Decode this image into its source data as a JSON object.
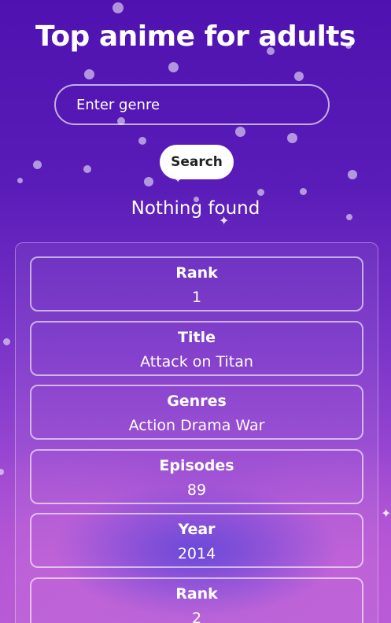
{
  "header": {
    "title": "Top anime for adults"
  },
  "search": {
    "placeholder": "Enter genre",
    "button_label": "Search"
  },
  "status": {
    "message": "Nothing found"
  },
  "results": [
    {
      "rank_label": "Rank",
      "rank": "1",
      "title_label": "Title",
      "title": "Attack on Titan",
      "genres_label": "Genres",
      "genres": "Action Drama War",
      "episodes_label": "Episodes",
      "episodes": "89",
      "year_label": "Year",
      "year": "2014"
    },
    {
      "rank_label": "Rank",
      "rank": "2"
    }
  ],
  "colors": {
    "background_top": "#4f12b0",
    "background_bottom": "#b35ad6",
    "button_bg": "#ffffff",
    "button_text": "#222222",
    "text": "#ffffff"
  },
  "icons": [
    "star-sparkle-icon"
  ]
}
